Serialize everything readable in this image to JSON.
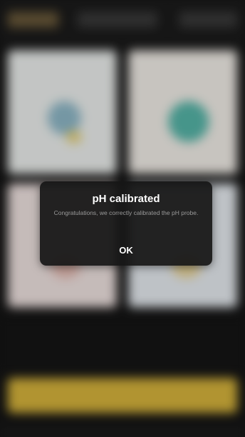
{
  "dialog": {
    "title": "pH calibrated",
    "message": "Congratulations, we correctly calibrated the pH probe.",
    "ok_label": "OK"
  },
  "colors": {
    "dialog_background": "#161616",
    "accent_button": "#d8b53c",
    "title_text": "#ffffff",
    "message_text": "#9a9a9a"
  }
}
